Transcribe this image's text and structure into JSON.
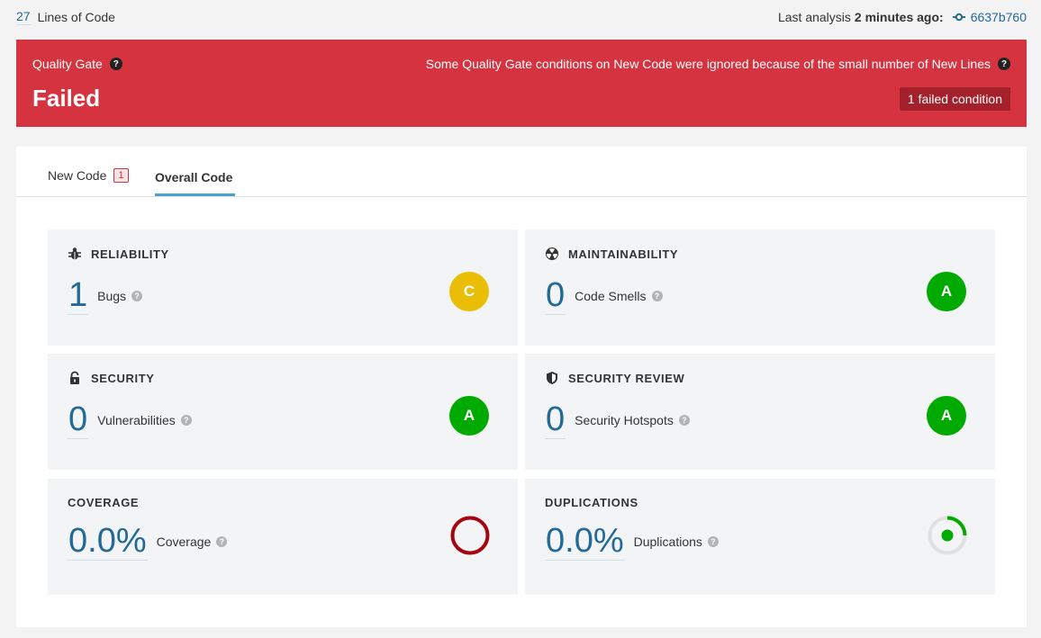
{
  "top": {
    "loc_value": "27",
    "loc_label": "Lines of Code",
    "analysis_prefix": "Last analysis",
    "analysis_time": "2 minutes ago:",
    "commit": "6637b760"
  },
  "gate": {
    "title": "Quality Gate",
    "status": "Failed",
    "note": "Some Quality Gate conditions on New Code were ignored because of the small number of New Lines",
    "badge": "1 failed condition",
    "color": "#d4333f"
  },
  "tabs": {
    "new_code": "New Code",
    "new_code_count": "1",
    "overall_code": "Overall Code"
  },
  "panels": {
    "reliability": {
      "title": "RELIABILITY",
      "value": "1",
      "label": "Bugs",
      "rating": "C",
      "rating_color": "#eabe06",
      "icon": "bug-icon"
    },
    "maintainability": {
      "title": "MAINTAINABILITY",
      "value": "0",
      "label": "Code Smells",
      "rating": "A",
      "rating_color": "#00aa00",
      "icon": "radiation-icon"
    },
    "security": {
      "title": "SECURITY",
      "value": "0",
      "label": "Vulnerabilities",
      "rating": "A",
      "rating_color": "#00aa00",
      "icon": "lock-icon"
    },
    "security_review": {
      "title": "SECURITY REVIEW",
      "value": "0",
      "label": "Security Hotspots",
      "rating": "A",
      "rating_color": "#00aa00",
      "icon": "shield-icon"
    },
    "coverage": {
      "title": "COVERAGE",
      "value": "0.0%",
      "label": "Coverage",
      "coverage_fraction": 0.0,
      "icon": "coverage-ring-icon"
    },
    "duplications": {
      "title": "DUPLICATIONS",
      "value": "0.0%",
      "label": "Duplications",
      "icon": "duplications-ring-icon"
    }
  }
}
